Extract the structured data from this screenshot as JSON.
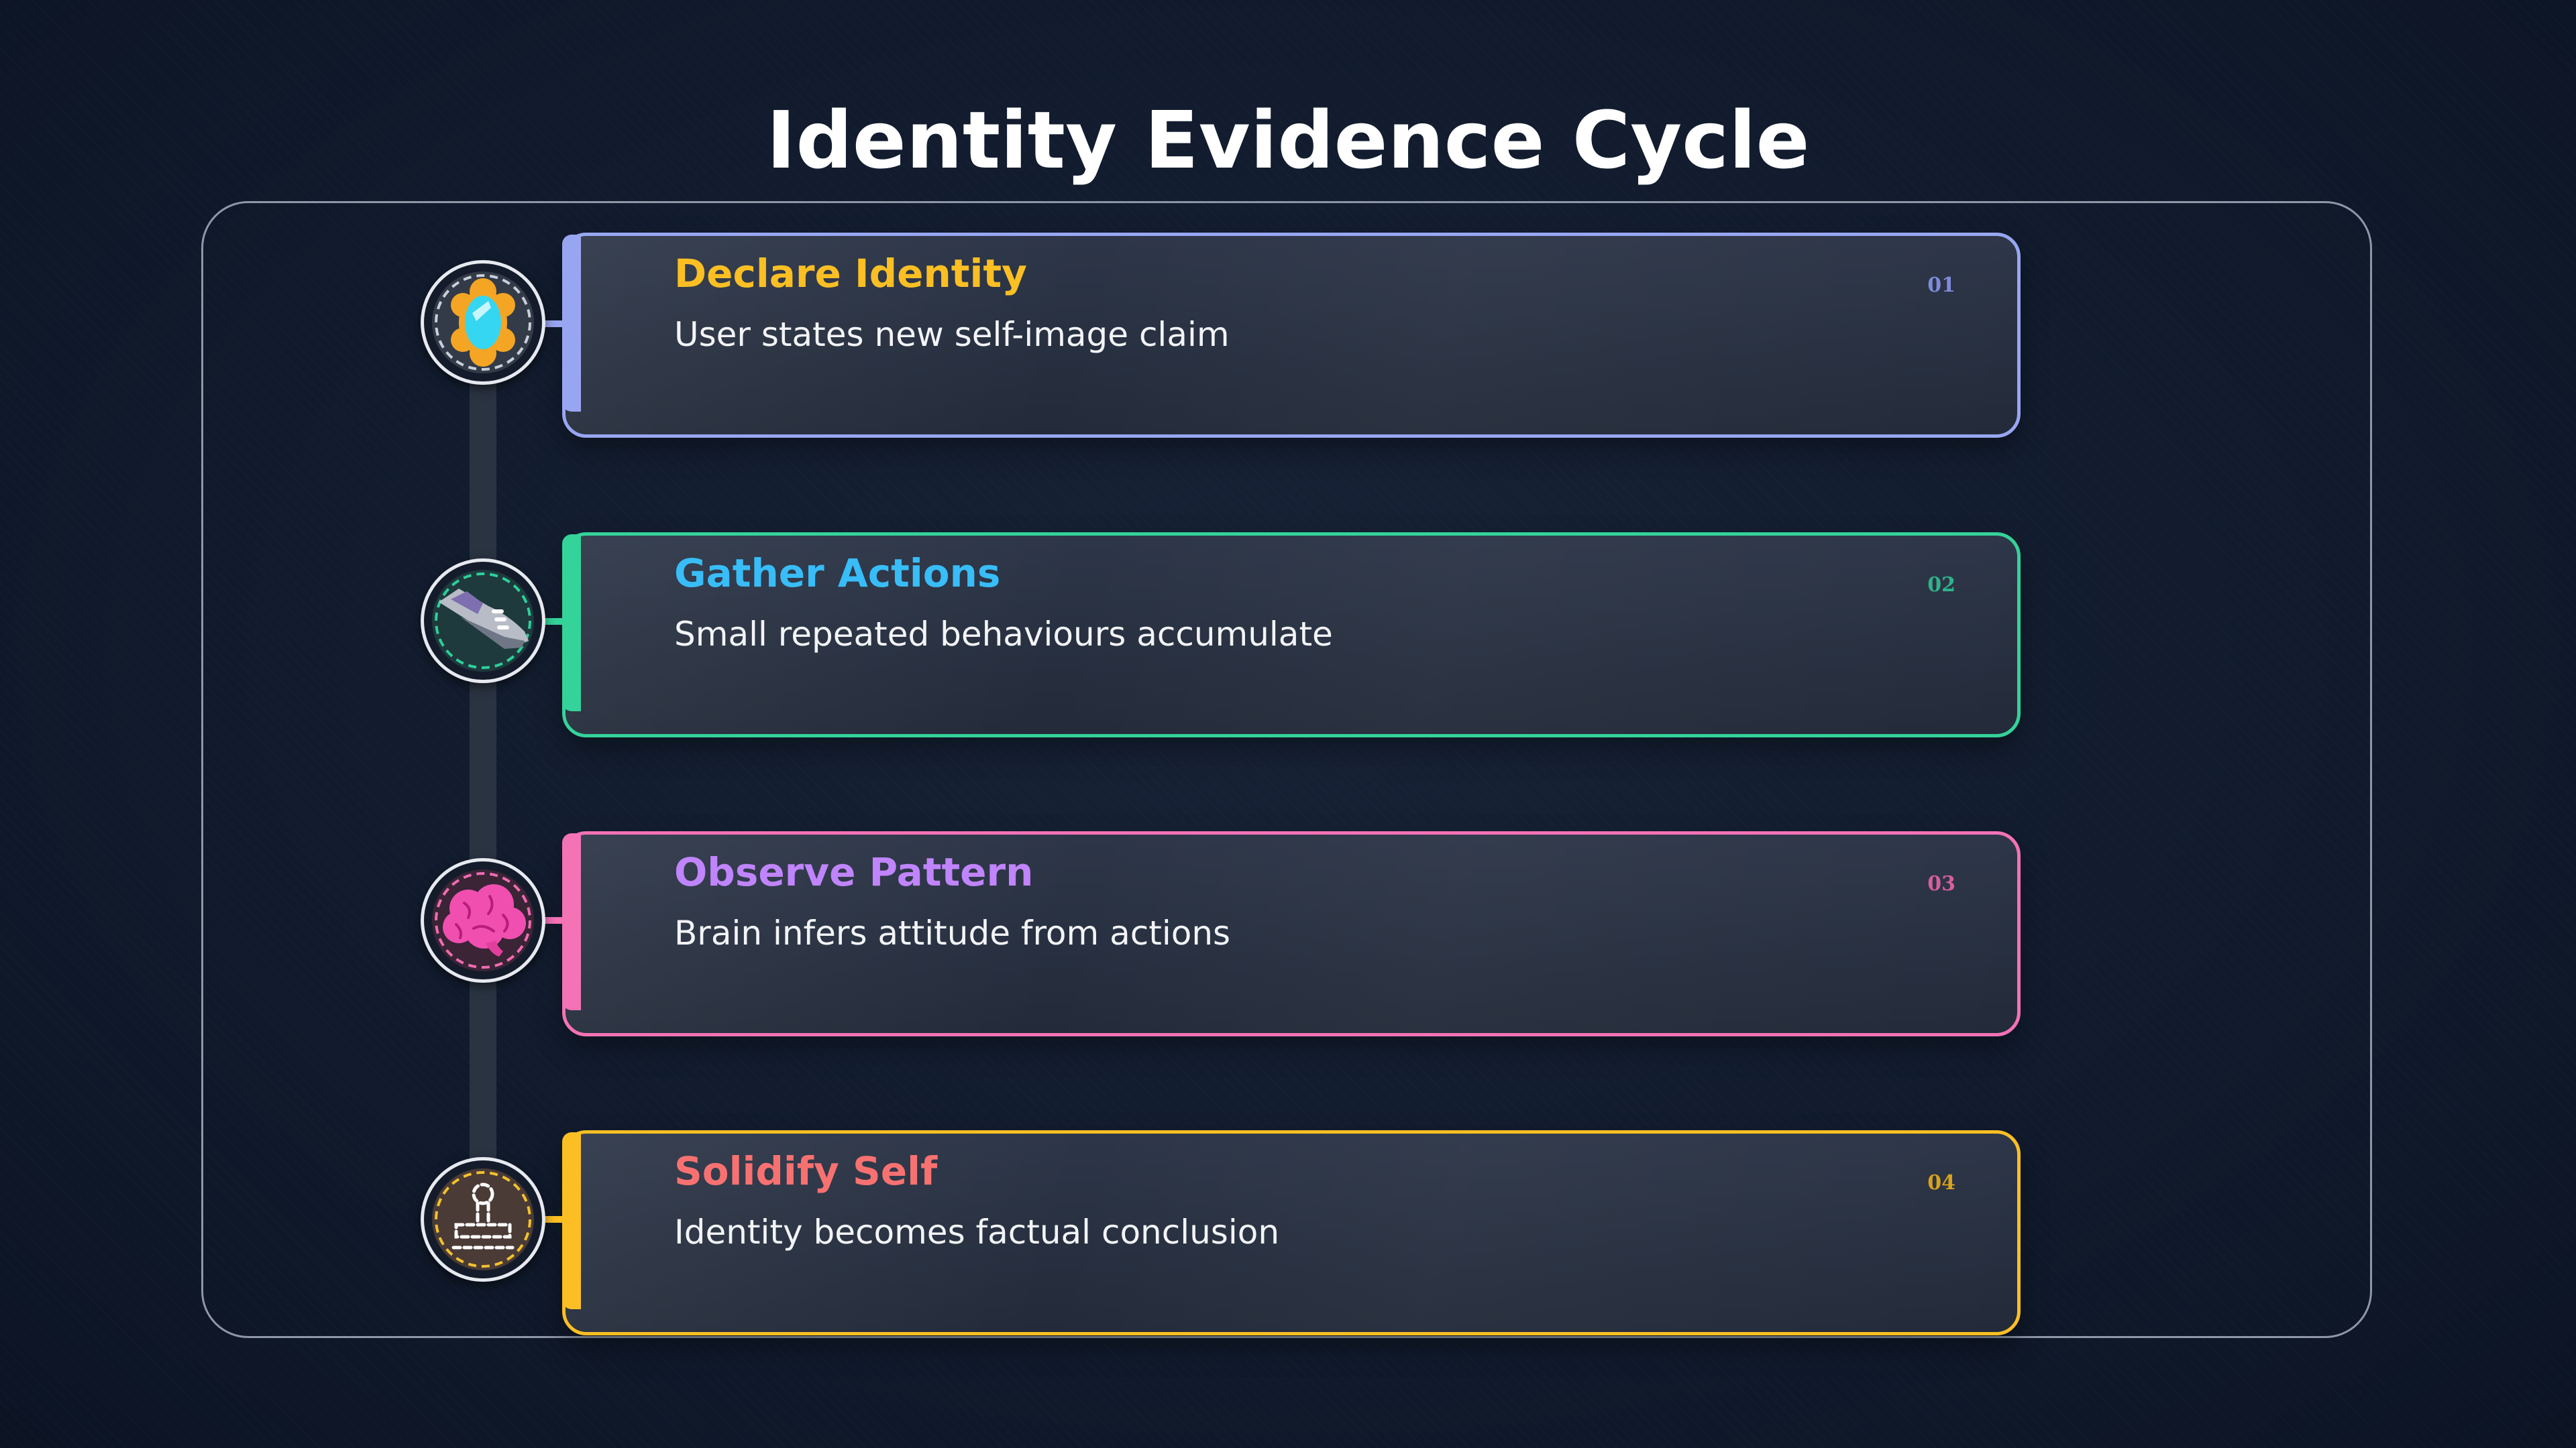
{
  "title": "Identity Evidence Cycle",
  "steps": [
    {
      "number": "01",
      "title": "Declare Identity",
      "description": "User states new self-image claim",
      "border_color": "#98a6f2",
      "title_color": "#fbbf24",
      "number_color": "#7f8cdc",
      "icon": "mirror-icon"
    },
    {
      "number": "02",
      "title": "Gather Actions",
      "description": "Small repeated behaviours accumulate",
      "border_color": "#34d399",
      "title_color": "#38bdf8",
      "number_color": "#2fb38a",
      "icon": "sneaker-icon"
    },
    {
      "number": "03",
      "title": "Observe Pattern",
      "description": "Brain infers attitude from actions",
      "border_color": "#f472b6",
      "title_color": "#c084fc",
      "number_color": "#d65f9c",
      "icon": "brain-icon"
    },
    {
      "number": "04",
      "title": "Solidify Self",
      "description": "Identity becomes factual conclusion",
      "border_color": "#fbbf24",
      "title_color": "#f87171",
      "number_color": "#d9a21c",
      "icon": "stamp-icon"
    }
  ]
}
